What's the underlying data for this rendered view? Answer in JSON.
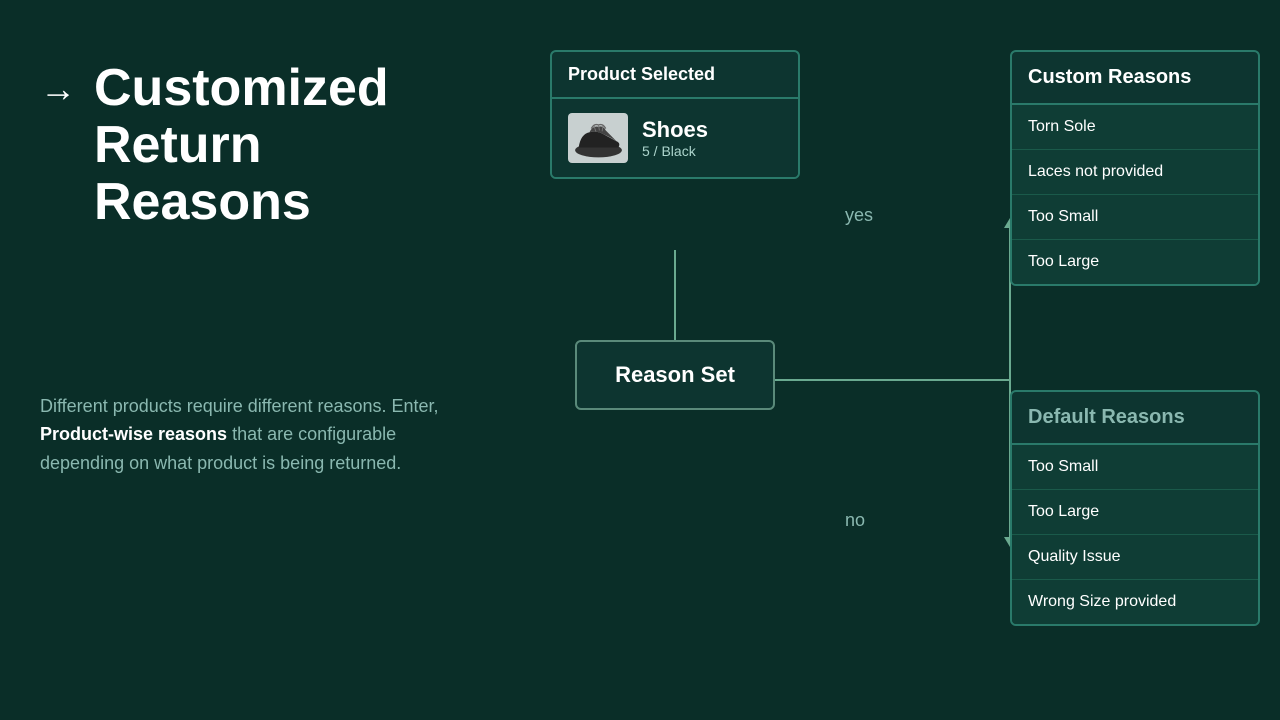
{
  "left": {
    "arrow": "→",
    "title_line1": "Customized",
    "title_line2": "Return",
    "title_line3": "Reasons",
    "description_part1": "Different products require different reasons. Enter, ",
    "description_bold": "Product-wise reasons",
    "description_part2": " that are configurable depending on what product is being returned."
  },
  "diagram": {
    "product_selected_label": "Product Selected",
    "product_name": "Shoes",
    "product_sub": "5 / Black",
    "reason_set_label": "Reason Set",
    "yes_label": "yes",
    "no_label": "no",
    "custom_reasons": {
      "header": "Custom Reasons",
      "items": [
        "Torn Sole",
        "Laces not provided",
        "Too Small",
        "Too Large"
      ]
    },
    "default_reasons": {
      "header": "Default Reasons",
      "items": [
        "Too Small",
        "Too Large",
        "Quality Issue",
        "Wrong Size provided"
      ]
    }
  }
}
